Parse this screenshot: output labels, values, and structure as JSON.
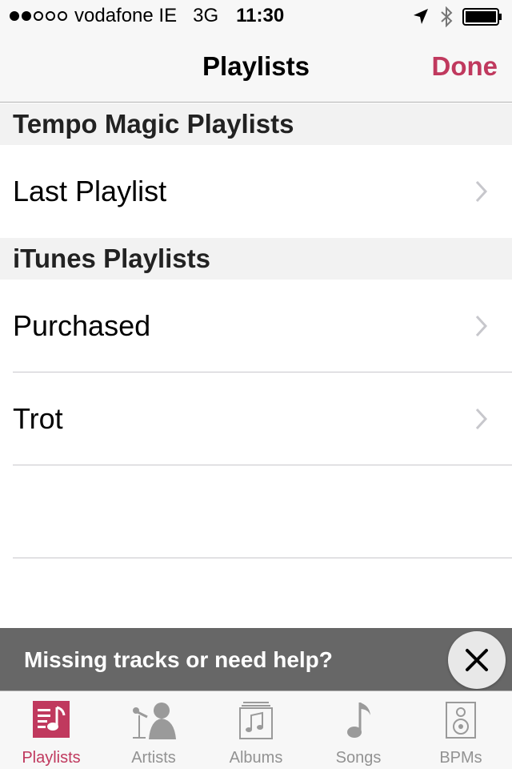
{
  "statusbar": {
    "carrier": "vodafone IE",
    "network": "3G",
    "time": "11:30",
    "signal_bars": 2,
    "signal_total": 5
  },
  "navbar": {
    "title": "Playlists",
    "done_label": "Done"
  },
  "sections": [
    {
      "header": "Tempo Magic Playlists",
      "rows": [
        "Last Playlist"
      ]
    },
    {
      "header": "iTunes Playlists",
      "rows": [
        "Purchased",
        "Trot"
      ]
    }
  ],
  "banner": {
    "text": "Missing tracks or need help?"
  },
  "tabs": [
    {
      "label": "Playlists",
      "icon": "playlists-icon",
      "active": true
    },
    {
      "label": "Artists",
      "icon": "artists-icon",
      "active": false
    },
    {
      "label": "Albums",
      "icon": "albums-icon",
      "active": false
    },
    {
      "label": "Songs",
      "icon": "songs-icon",
      "active": false
    },
    {
      "label": "BPMs",
      "icon": "bpms-icon",
      "active": false
    }
  ],
  "colors": {
    "accent": "#c0395e",
    "inactive_tab": "#929292",
    "banner_bg": "#5f5f5f"
  }
}
